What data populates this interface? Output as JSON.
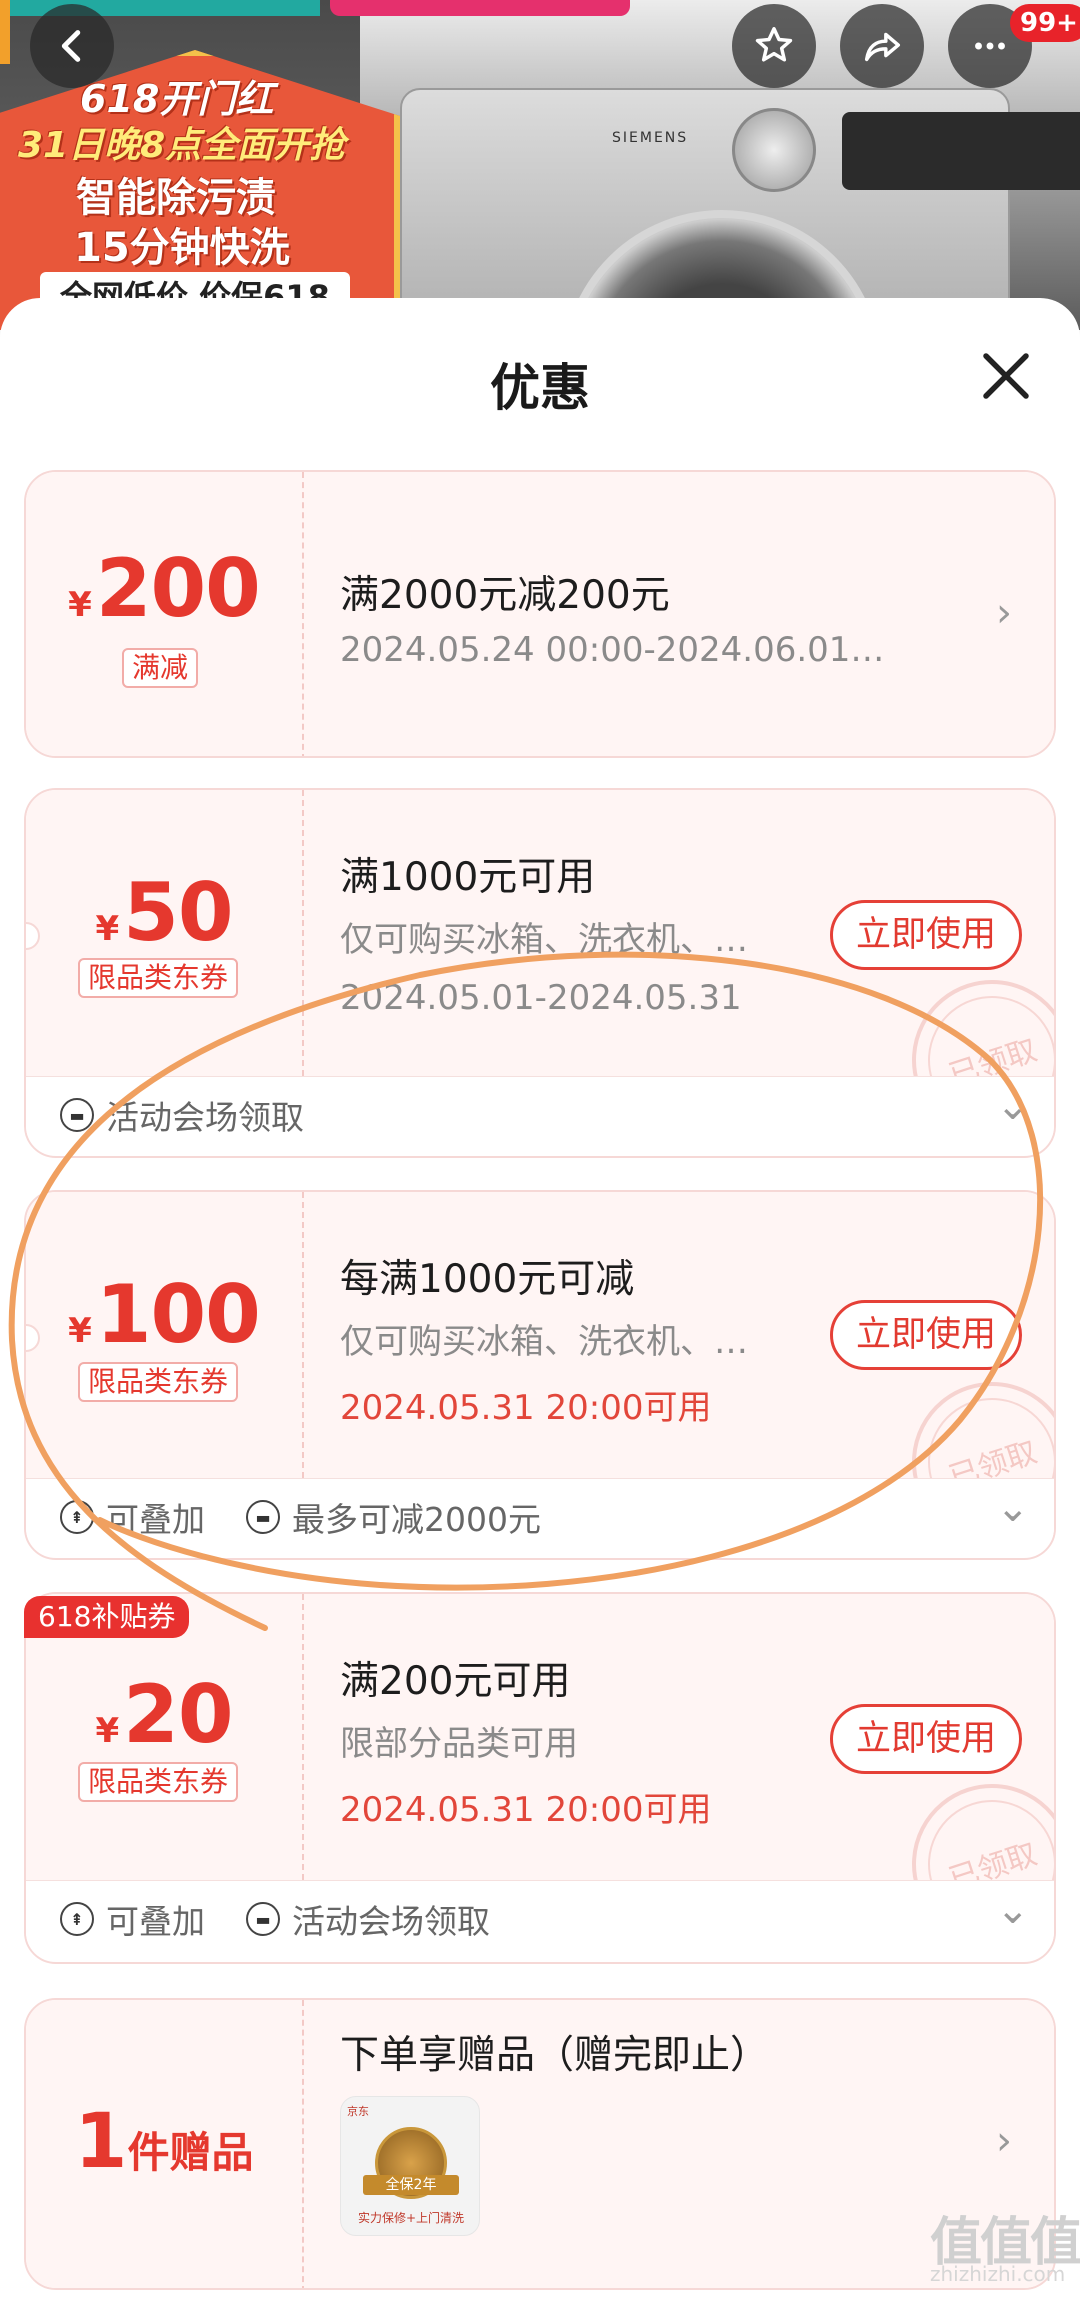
{
  "hero": {
    "promo_line1": "618开门红",
    "promo_line2": "31日晚8点全面开抢",
    "promo_line3": "智能除污渍",
    "promo_line4": "15分钟快洗",
    "promo_line5": "全网低价 价保618",
    "washer_brand": "SIEMENS",
    "badge": "99+",
    "icons": [
      "back-icon",
      "star-icon",
      "share-icon",
      "more-icon"
    ]
  },
  "sheet": {
    "title": "优惠"
  },
  "coupons": [
    {
      "currency": "¥",
      "amount": "200",
      "tag": "满减",
      "title": "满2000元减200元",
      "date": "2024.05.24 00:00-2024.06.01…"
    },
    {
      "currency": "¥",
      "amount": "50",
      "tag": "限品类东券",
      "title": "满1000元可用",
      "subtitle": "仅可购买冰箱、洗衣机、…",
      "date": "2024.05.01-2024.05.31",
      "button": "立即使用",
      "stamp": "已领取",
      "footer": [
        "活动会场领取"
      ]
    },
    {
      "currency": "¥",
      "amount": "100",
      "tag": "限品类东券",
      "title": "每满1000元可减",
      "subtitle": "仅可购买冰箱、洗衣机、…",
      "date": "2024.05.31 20:00可用",
      "button": "立即使用",
      "stamp": "已领取",
      "footer": [
        "可叠加",
        "最多可减2000元"
      ]
    },
    {
      "ribbon": "618补贴券",
      "currency": "¥",
      "amount": "20",
      "tag": "限品类东券",
      "title": "满200元可用",
      "subtitle": "限部分品类可用",
      "date": "2024.05.31 20:00可用",
      "button": "立即使用",
      "stamp": "已领取",
      "footer": [
        "可叠加",
        "活动会场领取"
      ]
    }
  ],
  "gift": {
    "count": "1",
    "unit": "件赠品",
    "title": "下单享赠品（赠完即止）",
    "thumb_logo": "京东",
    "thumb_seal": "全保2年",
    "thumb_caption": "实力保修+上门清洗"
  },
  "watermark": {
    "text": "值值值",
    "url": "zhizhizhi.com"
  },
  "colors": {
    "accent_red": "#e5382e",
    "annotation_orange": "#f0a060"
  }
}
